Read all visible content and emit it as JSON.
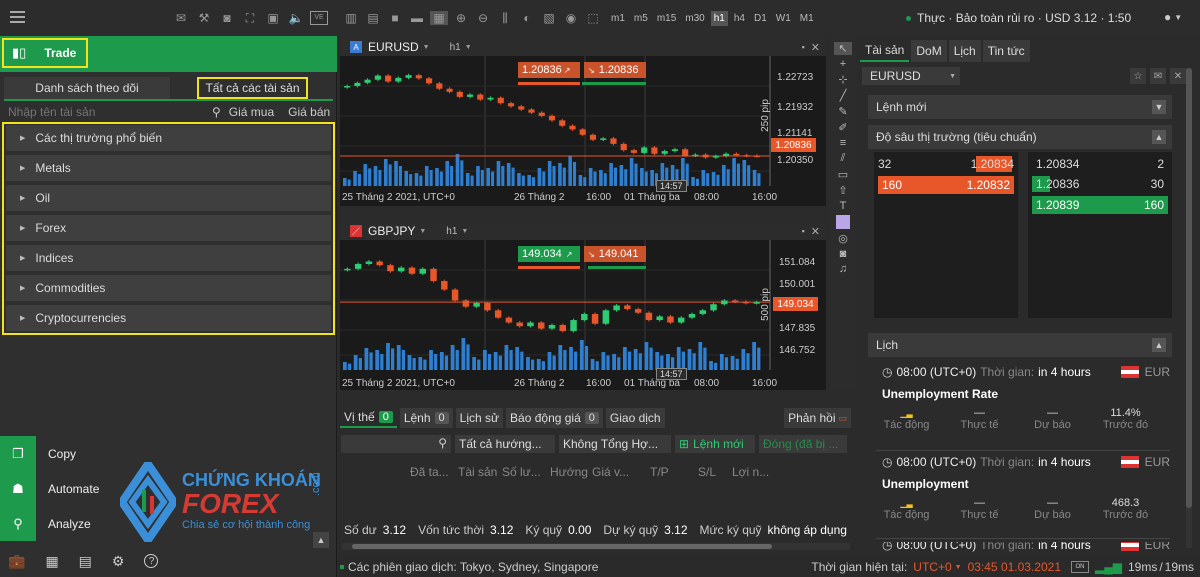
{
  "left": {
    "tabs": {
      "watchlist": "Danh sách theo dõi",
      "all": "Tất cả các tài sản"
    },
    "search_placeholder": "Nhập tên tài sản",
    "bid_label": "Giá mua",
    "ask_label": "Giá bán",
    "trade_label": "Trade",
    "categories": [
      "Các thị trường phổ biến",
      "Metals",
      "Oil",
      "Forex",
      "Indices",
      "Commodities",
      "Cryptocurrencies"
    ],
    "bottom_buttons": [
      "Copy",
      "Automate",
      "Analyze"
    ]
  },
  "watermark": {
    "line1": "CHỨNG KHOÁN",
    "line2": "FOREX",
    "domain": ".com",
    "slogan": "Chia sẻ cơ hội thành công"
  },
  "toolbar": {
    "timeframes": [
      "m1",
      "m5",
      "m15",
      "m30",
      "h1",
      "h4",
      "D1",
      "W1",
      "M1"
    ],
    "account_status": "Thực · Bảo toàn rủi ro · USD 3.12 · 1:50"
  },
  "charts": [
    {
      "symbol": "EURUSD",
      "timeframe": "h1",
      "bid": "1.20836",
      "ask": "1.20836",
      "price_label": "1.20836",
      "ticks": [
        "1.22723",
        "1.21932",
        "1.21141",
        "1.20350"
      ],
      "range_label": "250 pip",
      "xlabels": [
        "25 Tháng 2 2021, UTC+0",
        "26 Tháng 2",
        "16:00",
        "01 Tháng ba",
        "08:00",
        "16:00"
      ],
      "cursor_time": "14:57",
      "chart_data": {
        "type": "candlestick",
        "ylim": [
          1.203,
          1.23
        ],
        "closes": [
          1.2238,
          1.2245,
          1.2252,
          1.2261,
          1.2248,
          1.2256,
          1.2262,
          1.2255,
          1.2244,
          1.2232,
          1.2225,
          1.2214,
          1.2219,
          1.2208,
          1.2212,
          1.22,
          1.2193,
          1.2186,
          1.2179,
          1.2172,
          1.2162,
          1.215,
          1.2142,
          1.213,
          1.2119,
          1.2122,
          1.211,
          1.2096,
          1.209,
          1.2102,
          1.2088,
          1.2094,
          1.2098,
          1.2084,
          1.2086,
          1.208,
          1.2083,
          1.2088,
          1.2085,
          1.2084,
          1.2083
        ]
      }
    },
    {
      "symbol": "GBPJPY",
      "timeframe": "h1",
      "bid": "149.034",
      "ask": "149.041",
      "price_label": "149.034",
      "ticks": [
        "151.084",
        "150.001",
        "147.835",
        "146.752"
      ],
      "range_label": "500 pip",
      "xlabels": [
        "25 Tháng 2 2021, UTC+0",
        "26 Tháng 2",
        "16:00",
        "01 Tháng ba",
        "08:00",
        "16:00"
      ],
      "cursor_time": "14:57",
      "chart_data": {
        "type": "candlestick",
        "ylim": [
          146.5,
          151.5
        ],
        "closes": [
          150.4,
          150.6,
          150.7,
          150.55,
          150.3,
          150.45,
          150.2,
          150.4,
          149.9,
          149.55,
          149.1,
          148.85,
          149.0,
          148.7,
          148.4,
          148.2,
          148.05,
          148.2,
          147.95,
          148.1,
          147.85,
          148.3,
          148.55,
          148.15,
          148.7,
          148.9,
          148.75,
          148.6,
          148.3,
          148.45,
          148.2,
          148.4,
          148.55,
          148.7,
          148.95,
          149.1,
          149.05,
          149.0,
          149.034
        ]
      }
    }
  ],
  "bottom": {
    "tabs": [
      {
        "label": "Vị thế",
        "count": "0"
      },
      {
        "label": "Lệnh",
        "count": "0"
      },
      {
        "label": "Lịch sử"
      },
      {
        "label": "Báo động giá",
        "count": "0"
      },
      {
        "label": "Giao dịch"
      }
    ],
    "feedback": "Phản hồi",
    "filter_direction": "Tất cả hướng...",
    "filter_group": "Không Tổng Hợ...",
    "new_order": "Lệnh mới",
    "close_all": "Đóng (đã bị ...",
    "columns": [
      "Đã ta...",
      "Tài sản",
      "Số lư...",
      "Hướng",
      "Giá v...",
      "T/P",
      "S/L",
      "Lợi n..."
    ],
    "footer": [
      {
        "k": "Số dư",
        "v": "3.12"
      },
      {
        "k": "Vốn tức thời",
        "v": "3.12"
      },
      {
        "k": "Ký quỹ",
        "v": "0.00"
      },
      {
        "k": "Dự ký quỹ",
        "v": "3.12"
      },
      {
        "k": "Mức ký quỹ",
        "v": "không áp dụng"
      }
    ]
  },
  "status": {
    "sessions": "Các phiên giao dịch: Tokyo, Sydney, Singapore",
    "time_label": "Thời gian hiện tại:",
    "tz": "UTC+0",
    "time": "03:45 01.03.2021",
    "latency1": "19ms",
    "latency2": "19ms"
  },
  "right": {
    "tabs": [
      "Tài sản",
      "DoM",
      "Lịch",
      "Tin tức"
    ],
    "symbol": "EURUSD",
    "new_order": "Lệnh mới",
    "depth_title": "Độ sâu thị trường (tiêu chuẩn)",
    "depth_bids": [
      {
        "qty": "32",
        "price": "1.20834"
      },
      {
        "qty": "160",
        "price": "1.20832"
      }
    ],
    "depth_asks": [
      {
        "price": "1.20834",
        "qty": "2"
      },
      {
        "price": "1.20836",
        "qty": "30"
      },
      {
        "price": "1.20839",
        "qty": "160"
      }
    ],
    "calendar_title": "Lịch",
    "events": [
      {
        "time": "08:00 (UTC+0)",
        "time_label": "Thời gian:",
        "in": "in 4 hours",
        "cur": "EUR",
        "name": "Unemployment Rate",
        "impact_label": "Tác động",
        "actual_label": "Thực tế",
        "forecast_label": "Dự báo",
        "prev_label": "Trước đó",
        "actual": "—",
        "forecast": "—",
        "prev": "11.4%"
      },
      {
        "time": "08:00 (UTC+0)",
        "time_label": "Thời gian:",
        "in": "in 4 hours",
        "cur": "EUR",
        "name": "Unemployment",
        "impact_label": "Tác động",
        "actual_label": "Thực tế",
        "forecast_label": "Dự báo",
        "prev_label": "Trước đó",
        "actual": "—",
        "forecast": "—",
        "prev": "468.3"
      },
      {
        "time": "08:00 (UTC+0)",
        "time_label": "Thời gian:",
        "in": "in 4 hours",
        "cur": "EUR"
      }
    ]
  },
  "colors": {
    "green": "#1d9a4b",
    "red": "#e8572a",
    "yellow": "#f2e31b",
    "bg": "#1a1a1a"
  }
}
